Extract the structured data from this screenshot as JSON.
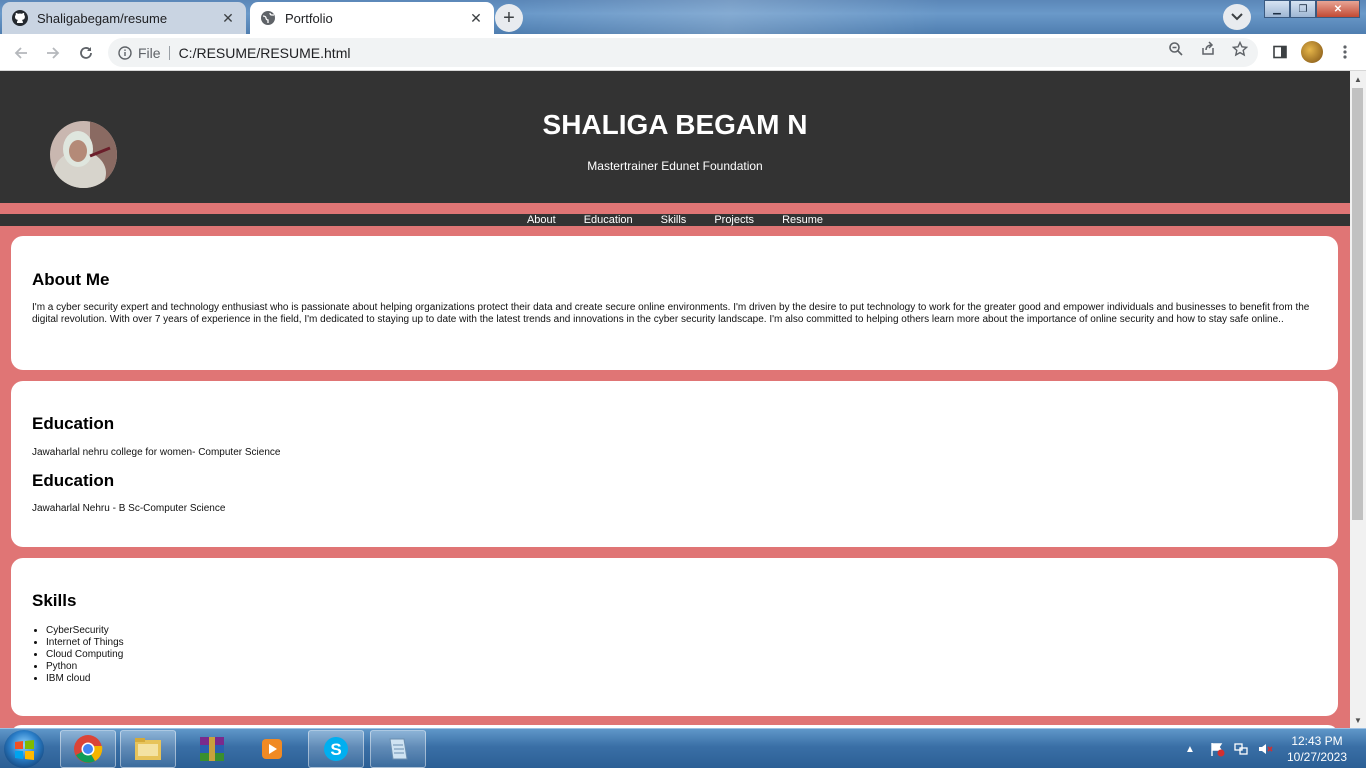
{
  "browser": {
    "tabs": [
      {
        "title": "Shaligabegam/resume",
        "icon": "github-icon"
      },
      {
        "title": "Portfolio",
        "icon": "globe-icon"
      }
    ],
    "address": {
      "scheme_label": "File",
      "url": "C:/RESUME/RESUME.html"
    }
  },
  "page": {
    "name": "SHALIGA BEGAM N",
    "tagline": "Mastertrainer Edunet Foundation",
    "nav": [
      "About",
      "Education",
      "Skills",
      "Projects",
      "Resume"
    ],
    "about": {
      "heading": "About Me",
      "text": "I'm a cyber security expert and technology enthusiast who is passionate about helping organizations protect their data and create secure online environments. I'm driven by the desire to put technology to work for the greater good and empower individuals and businesses to benefit from the digital revolution. With over 7 years of experience in the field, I'm dedicated to staying up to date with the latest trends and innovations in the cyber security landscape. I'm also committed to helping others learn more about the importance of online security and how to stay safe online.."
    },
    "education": [
      {
        "heading": "Education",
        "text": "Jawaharlal nehru college for women- Computer Science"
      },
      {
        "heading": "Education",
        "text": "Jawaharlal Nehru - B Sc-Computer Science"
      }
    ],
    "skills": {
      "heading": "Skills",
      "items": [
        "CyberSecurity",
        "Internet of Things",
        "Cloud Computing",
        "Python",
        "IBM cloud"
      ]
    },
    "colors": {
      "header_bg": "#333333",
      "page_bg": "#e07575",
      "card_bg": "#ffffff"
    }
  },
  "taskbar": {
    "time": "12:43 PM",
    "date": "10/27/2023",
    "pinned": [
      "chrome-icon",
      "file-explorer-icon",
      "winrar-icon",
      "media-player-icon",
      "skype-icon",
      "notepad-icon"
    ]
  }
}
